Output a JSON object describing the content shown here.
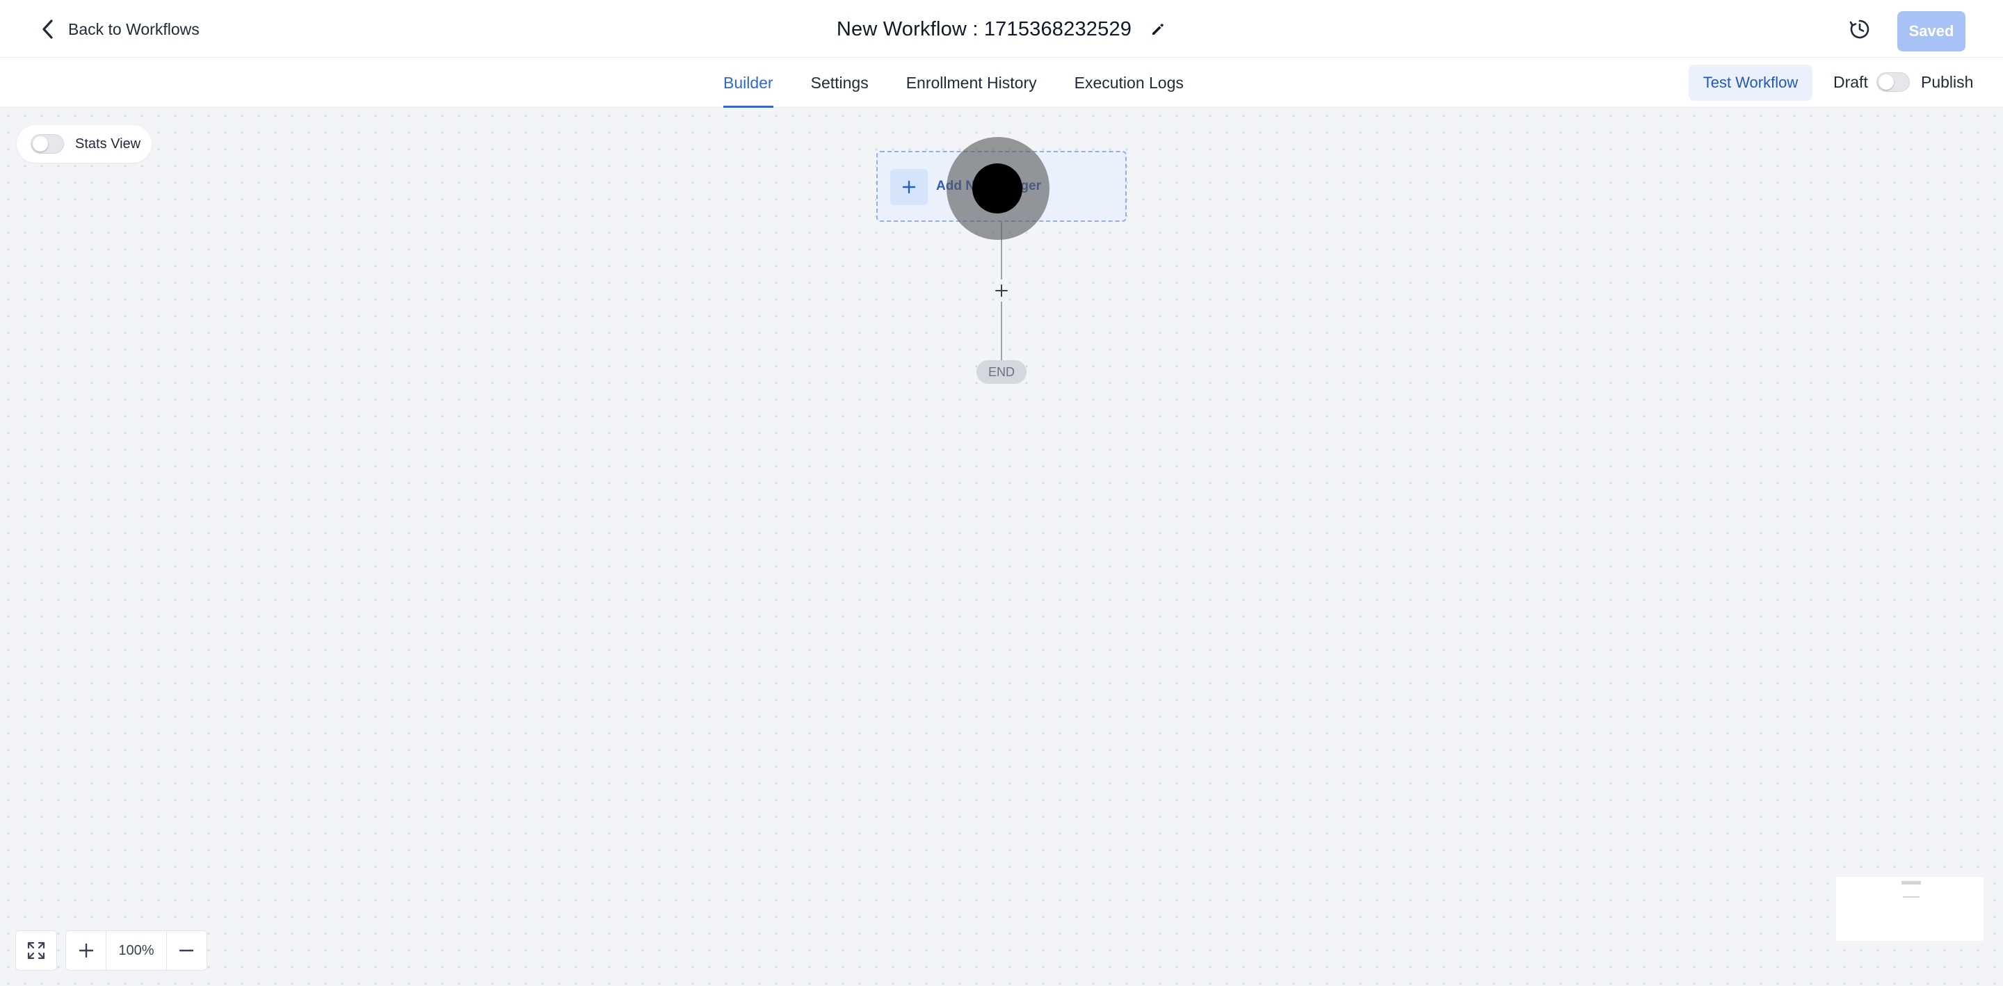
{
  "header": {
    "back_label": "Back to Workflows",
    "title": "New Workflow : 1715368232529",
    "saved_label": "Saved",
    "icons": {
      "back": "chevron-left-icon",
      "edit": "pencil-icon",
      "history": "history-icon"
    }
  },
  "tabs": [
    {
      "label": "Builder",
      "active": true
    },
    {
      "label": "Settings",
      "active": false
    },
    {
      "label": "Enrollment History",
      "active": false
    },
    {
      "label": "Execution Logs",
      "active": false
    }
  ],
  "actions": {
    "test_workflow_label": "Test Workflow",
    "draft_label": "Draft",
    "publish_label": "Publish",
    "publish_enabled": false
  },
  "canvas": {
    "stats_view_label": "Stats View",
    "stats_view_enabled": false,
    "trigger_label": "Add New Trigger",
    "end_label": "END"
  },
  "zoom": {
    "level": "100%"
  },
  "colors": {
    "accent": "#2b6ad4",
    "saved_button": "#a9c2f5",
    "canvas_bg": "#f2f4f8",
    "trigger_bg": "#eaf1fd"
  }
}
